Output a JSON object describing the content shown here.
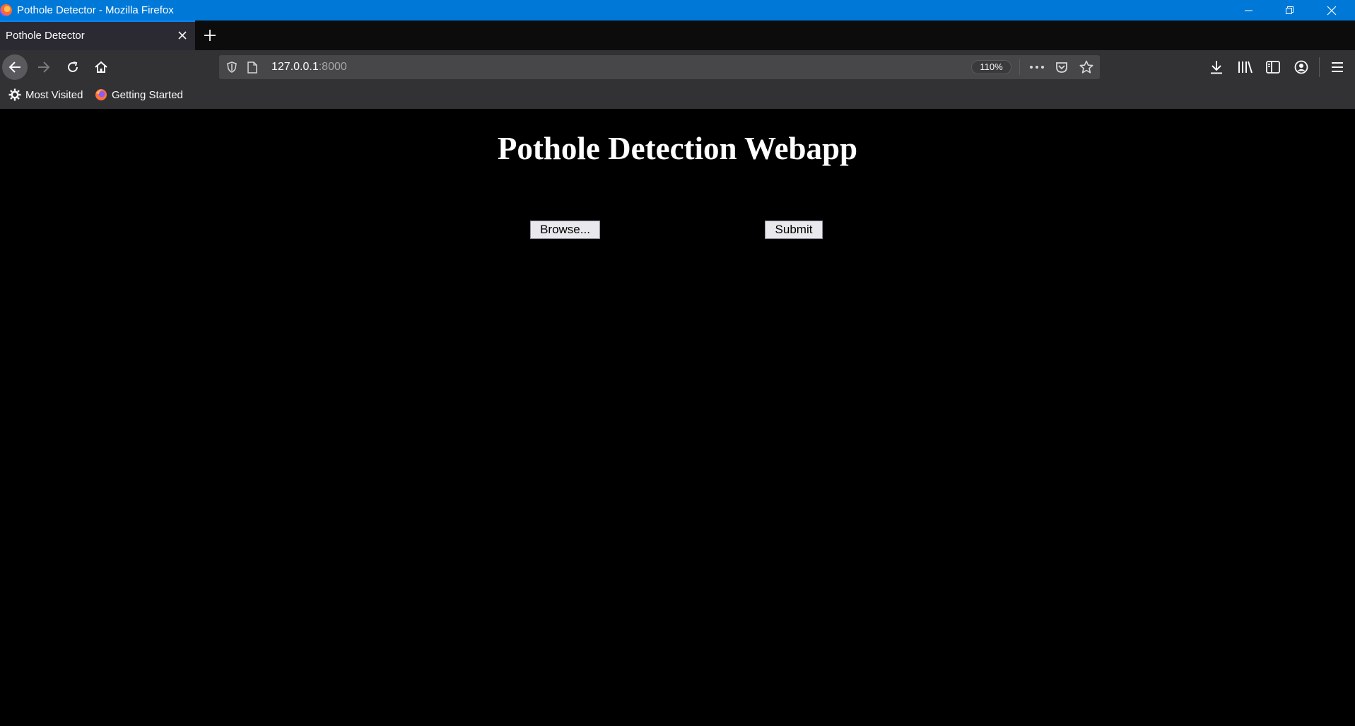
{
  "window": {
    "title": "Pothole Detector - Mozilla Firefox",
    "controls": [
      "minimize-icon",
      "restore-icon",
      "close-icon"
    ]
  },
  "tabs": [
    {
      "label": "Pothole Detector",
      "active": true
    }
  ],
  "navbar": {
    "url_host": "127.0.0.1",
    "url_port": ":8000",
    "zoom": "110%"
  },
  "bookmarks": [
    {
      "label": "Most Visited",
      "icon": "gear-icon"
    },
    {
      "label": "Getting Started",
      "icon": "firefox-icon"
    }
  ],
  "page": {
    "heading": "Pothole Detection Webapp",
    "browse_label": "Browse...",
    "submit_label": "Submit"
  },
  "colors": {
    "titlebar": "#0078d7",
    "page_background": "#000000"
  }
}
